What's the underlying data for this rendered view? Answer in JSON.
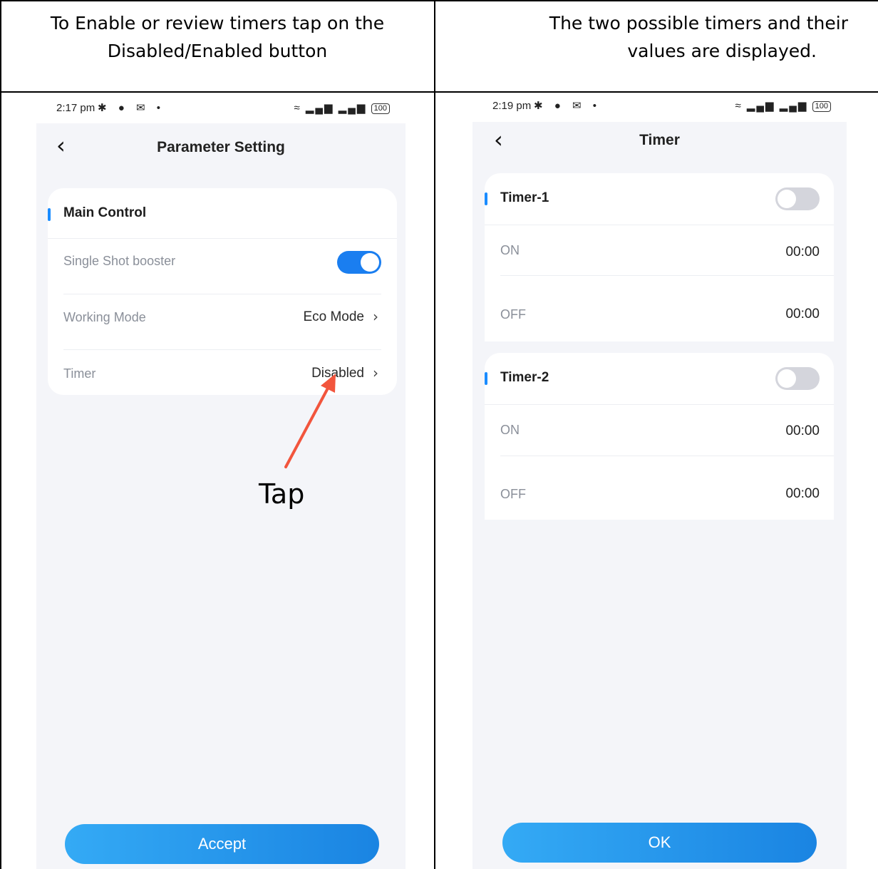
{
  "left_column": {
    "instruction": "To Enable or review timers tap on the Disabled/Enabled button",
    "instruction_line1": "To Enable or review timers tap on the",
    "instruction_line2": "Disabled/Enabled button",
    "phone": {
      "status_time": "2:17 pm",
      "status_icons": "bluetooth-icon chat-icon mail-icon dot-icon",
      "battery": "100",
      "back_icon": "back-chevron-icon",
      "title": "Parameter Setting",
      "section_title": "Main Control",
      "rows": [
        {
          "label": "Single Shot booster",
          "control": "toggle",
          "state": "on"
        },
        {
          "label": "Working Mode",
          "value": "Eco Mode"
        },
        {
          "label": "Timer",
          "value": "Disabled"
        }
      ],
      "annotation": "Tap",
      "annotation_color": "#f2553d",
      "button_label": "Accept"
    }
  },
  "right_column": {
    "instruction": "The two possible timers and their values are displayed.",
    "instruction_line1": "The two possible timers and their",
    "instruction_line2": "values are displayed.",
    "phone": {
      "status_time": "2:19 pm",
      "battery": "100",
      "title": "Timer",
      "timers": [
        {
          "name": "Timer-1",
          "enabled": false,
          "on_label": "ON",
          "on_value": "00:00",
          "off_label": "OFF",
          "off_value": "00:00"
        },
        {
          "name": "Timer-2",
          "enabled": false,
          "on_label": "ON",
          "on_value": "00:00",
          "off_label": "OFF",
          "off_value": "00:00"
        }
      ],
      "button_label": "OK"
    }
  },
  "colors": {
    "accent": "#1a8cff",
    "button": "#2a9bef",
    "background": "#f4f5f9"
  }
}
